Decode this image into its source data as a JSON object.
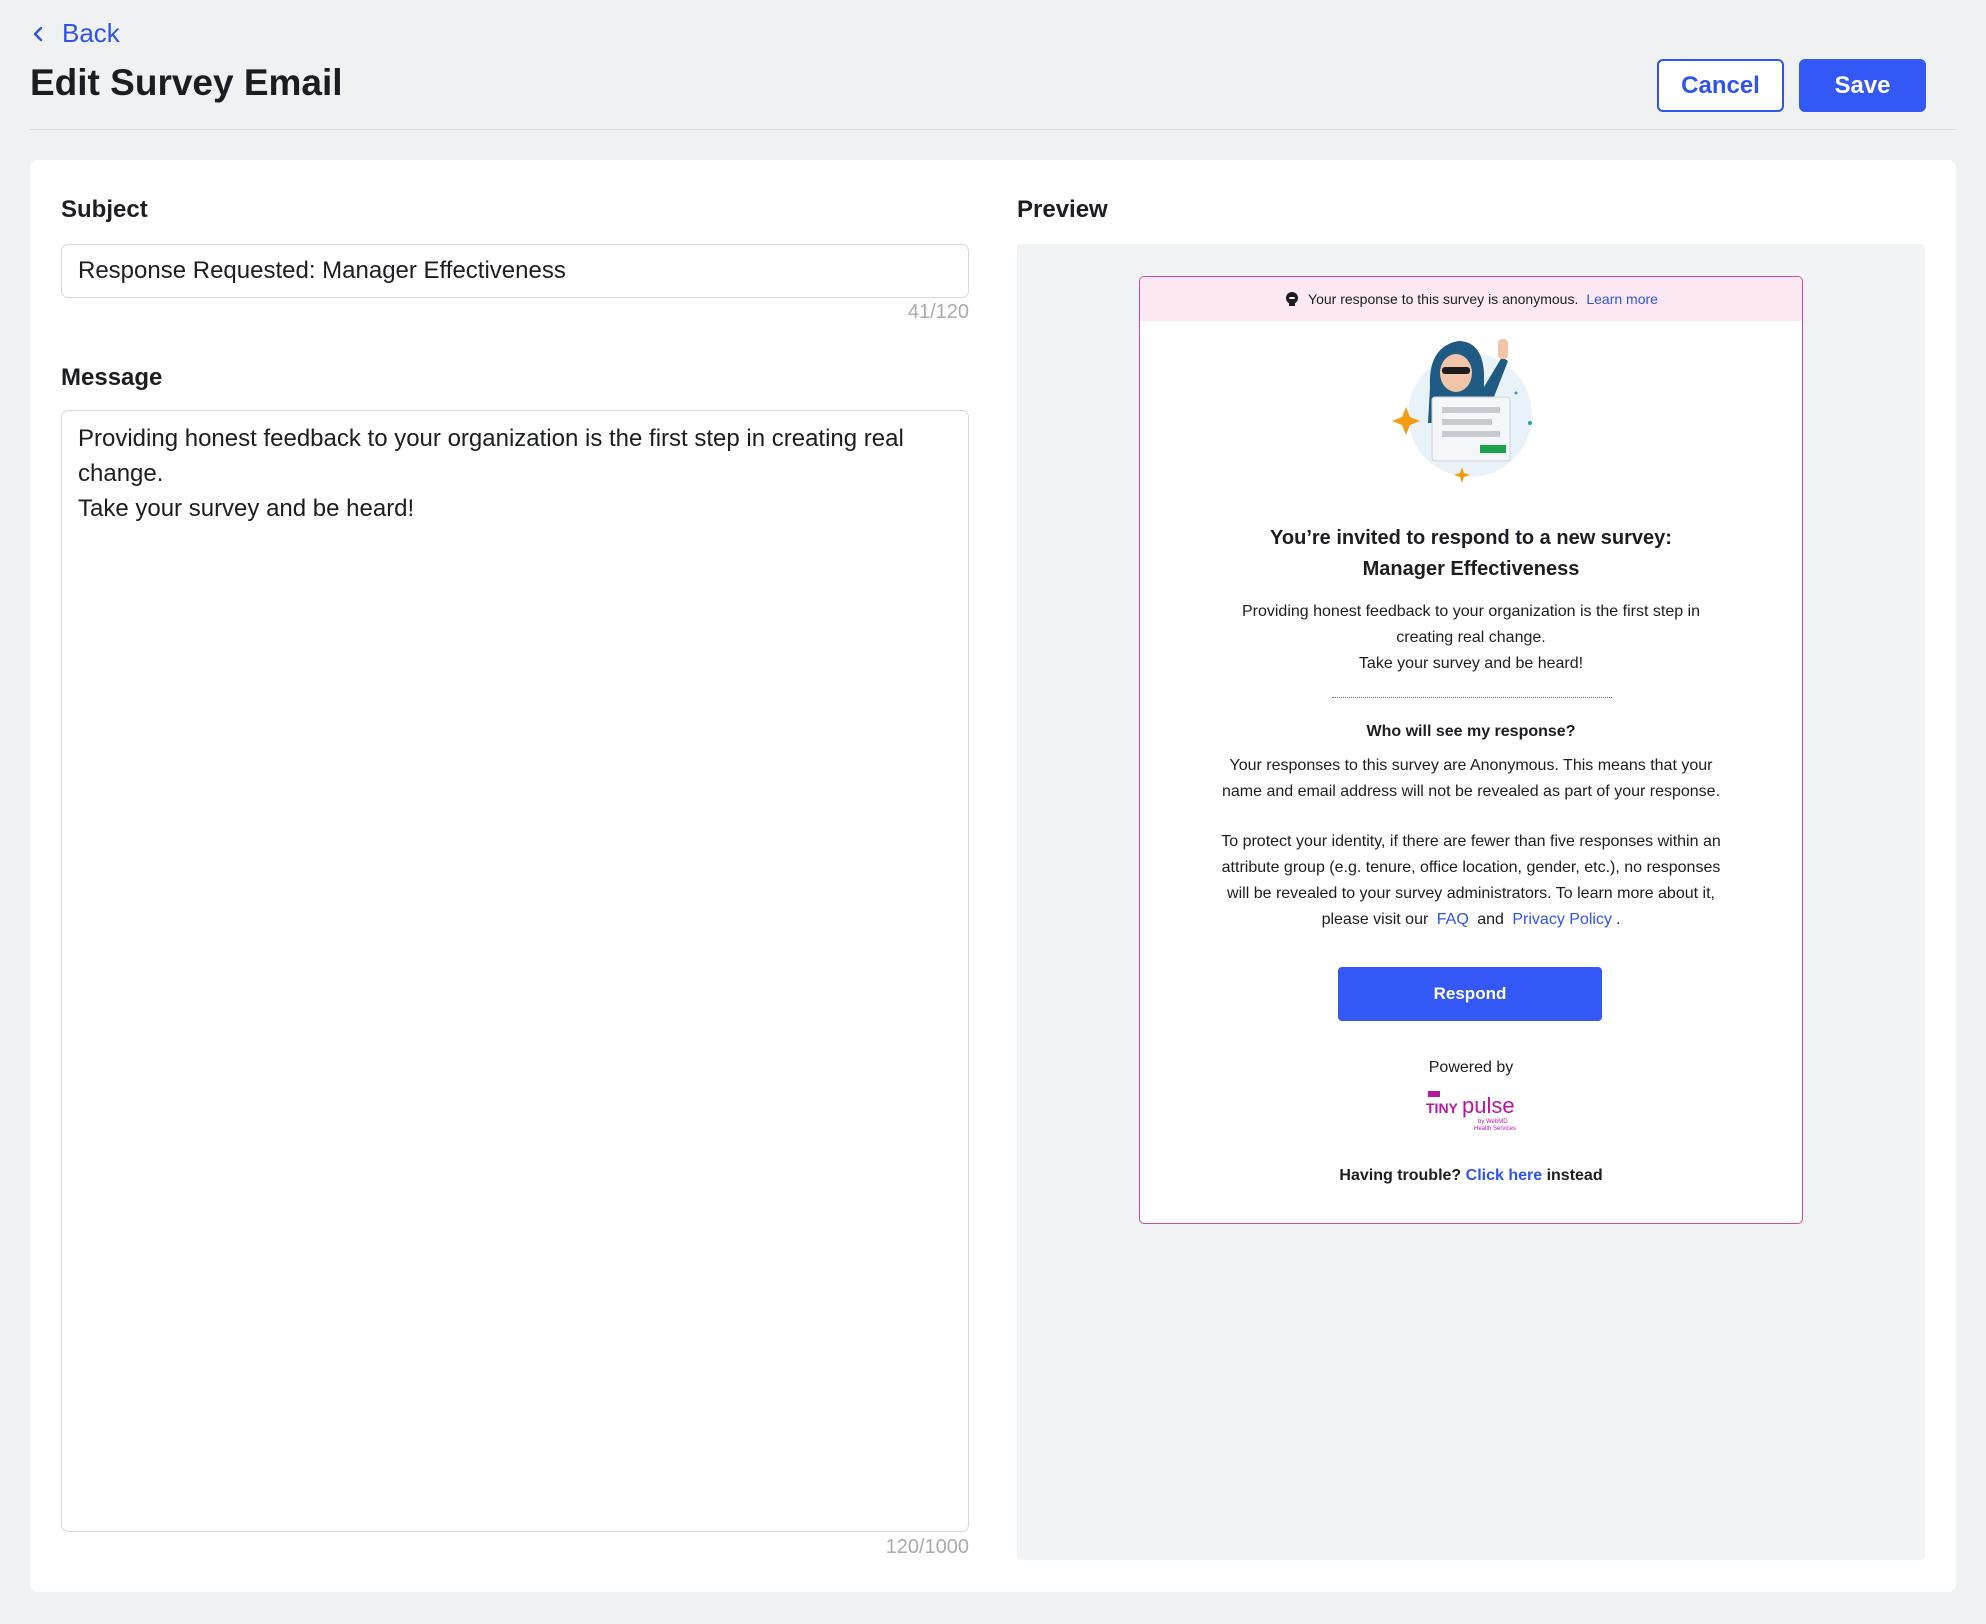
{
  "header": {
    "back_label": "Back",
    "title": "Edit Survey Email",
    "cancel_label": "Cancel",
    "save_label": "Save"
  },
  "form": {
    "subject_label": "Subject",
    "subject_value": "Response Requested: Manager Effectiveness",
    "subject_counter": "41/120",
    "message_label": "Message",
    "message_lines": [
      "Providing honest feedback to your organization is the first step in creating real",
      "change.",
      "Take your survey and be heard!"
    ],
    "message_counter": "120/1000"
  },
  "preview": {
    "label": "Preview",
    "banner_text": "Your response to this survey is anonymous.",
    "banner_link": "Learn more",
    "title_line1": "You’re invited to respond to a new survey:",
    "title_line2": "Manager Effectiveness",
    "body_lines": [
      "Providing honest feedback to your organization is the first step in",
      "creating real change.",
      "Take your survey and be heard!"
    ],
    "question": "Who will see my response?",
    "answer_lines": [
      "Your responses to this survey are Anonymous. This means that your",
      "name and email address will not be revealed as part of your response."
    ],
    "protect_lines": [
      "To protect your identity, if there are fewer than five responses within an",
      "attribute group (e.g. tenure, office location, gender, etc.), no responses",
      "will be revealed to your survey administrators. To learn more about it,"
    ],
    "protect_visit": "please visit our",
    "faq_link": "FAQ",
    "and_word": "and",
    "privacy_link": "Privacy Policy",
    "period": ".",
    "respond_label": "Respond",
    "powered_by": "Powered by",
    "trouble_text": "Having trouble?",
    "click_here": "Click here",
    "instead": "instead",
    "colors": {
      "accent": "#3358f5",
      "border": "#d24aa6",
      "banner": "#fbe8f3"
    }
  }
}
